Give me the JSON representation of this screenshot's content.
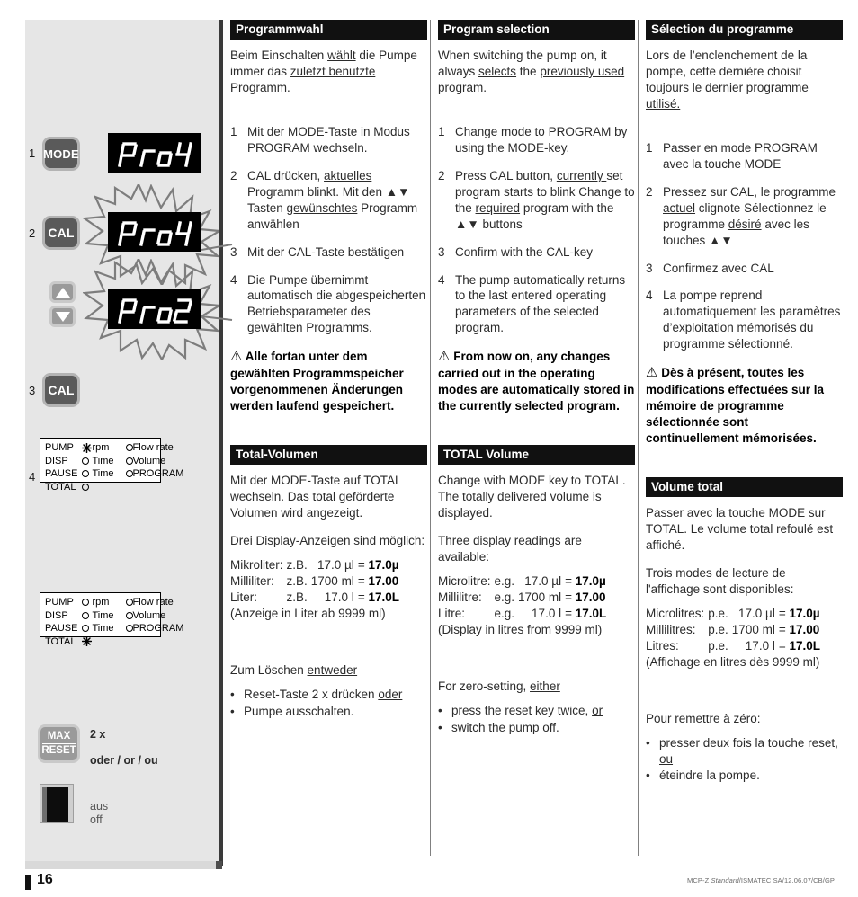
{
  "page": {
    "number": "16",
    "footer_right_prefix": "MCP-Z ",
    "footer_right_italic": "Standard",
    "footer_right_suffix": "/ISMATEC SA/12.06.07/CB/GP"
  },
  "illustration": {
    "steps": [
      "1",
      "2",
      "3",
      "4"
    ],
    "buttons": {
      "mode": "MODE",
      "cal_1": "CAL",
      "cal_2": "CAL",
      "max": "MAX",
      "reset": "RESET"
    },
    "displays": {
      "lcd_1": "Pro4",
      "lcd_2": "Pro4",
      "lcd_3": "Pro2"
    },
    "notes": {
      "two_x": "2 x",
      "or_trilingual": "oder / or / ou",
      "off_de": "aus",
      "off_en": "off"
    },
    "status_panel_1": {
      "rows": [
        {
          "label": "PUMP",
          "c1_mark": "star",
          "c1_text": "rpm",
          "c2_mark": "ring",
          "c2_text": "Flow rate"
        },
        {
          "label": "DISP",
          "c1_mark": "ring",
          "c1_text": "Time",
          "c2_mark": "ring",
          "c2_text": "Volume"
        },
        {
          "label": "PAUSE",
          "c1_mark": "ring",
          "c1_text": "Time",
          "c2_mark": "ring",
          "c2_text": "PROGRAM"
        },
        {
          "label": "TOTAL",
          "c1_mark": "ring",
          "c1_text": "",
          "c2_mark": "",
          "c2_text": ""
        }
      ]
    },
    "status_panel_2": {
      "rows": [
        {
          "label": "PUMP",
          "c1_mark": "ring",
          "c1_text": "rpm",
          "c2_mark": "ring",
          "c2_text": "Flow rate"
        },
        {
          "label": "DISP",
          "c1_mark": "ring",
          "c1_text": "Time",
          "c2_mark": "ring",
          "c2_text": "Volume"
        },
        {
          "label": "PAUSE",
          "c1_mark": "ring",
          "c1_text": "Time",
          "c2_mark": "ring",
          "c2_text": "PROGRAM"
        },
        {
          "label": "TOTAL",
          "c1_mark": "star",
          "c1_text": "",
          "c2_mark": "",
          "c2_text": ""
        }
      ]
    }
  },
  "columns": {
    "de": {
      "section1": {
        "heading": "Programmwahl",
        "intro_a": "Beim Einschalten ",
        "intro_u1": "wählt",
        "intro_b": " die Pumpe immer das ",
        "intro_u2": "zuletzt benutzte",
        "intro_c": " Programm.",
        "steps": [
          {
            "n": "1",
            "text": "Mit der MODE-Taste in Modus PROGRAM wechseln."
          },
          {
            "n": "2",
            "a": "CAL drücken, ",
            "u1": "aktuelles",
            "b": " Programm blinkt. Mit den ▲▼ Tasten ",
            "u2": "gewünschtes",
            "c": " Programm anwählen"
          },
          {
            "n": "3",
            "text": "Mit der CAL-Taste bestätigen"
          },
          {
            "n": "4",
            "text": "Die Pumpe übernimmt automatisch die abgespeicherten Betriebsparameter des gewählten Programms."
          }
        ],
        "warning": "Alle fortan unter dem gewählten Programmspeicher vorgenommenen Änderungen werden laufend gespeichert."
      },
      "section2": {
        "heading": "Total-Volumen",
        "p1": "Mit der MODE-Taste auf TOTAL wechseln. Das total geförderte Volumen wird angezeigt.",
        "p2": "Drei Display-Anzeigen sind möglich:",
        "units": [
          {
            "name": "Mikroliter:",
            "eg": "z.B.",
            "value": "17.0 µl",
            "eq": "=",
            "result": "17.0µ"
          },
          {
            "name": "Milliliter:",
            "eg": "z.B.",
            "value": "1700 ml",
            "eq": "=",
            "result": "17.00"
          },
          {
            "name": "Liter:",
            "eg": "z.B.",
            "value": "17.0 l",
            "eq": "=",
            "result": "17.0L"
          }
        ],
        "note": "(Anzeige in Liter ab 9999 ml)",
        "reset_lead_a": "Zum Löschen ",
        "reset_lead_u": "entweder",
        "bullets": [
          {
            "a": "Reset-Taste 2 x drücken ",
            "u": "oder",
            "b": ""
          },
          {
            "a": "Pumpe ausschalten.",
            "u": "",
            "b": ""
          }
        ]
      }
    },
    "en": {
      "section1": {
        "heading": "Program selection",
        "intro_a": "When switching the pump on, it always ",
        "intro_u1": "selects",
        "intro_b": " the ",
        "intro_u2": "previously used",
        "intro_c": " program.",
        "steps": [
          {
            "n": "1",
            "text": "Change mode to PROGRAM by using the MODE-key."
          },
          {
            "n": "2",
            "a": "Press CAL button, ",
            "u1": "currently ",
            "b": "set program starts to blink Change to the ",
            "u2": "required",
            "c": " program with the ▲▼ buttons"
          },
          {
            "n": "3",
            "text": "Confirm with the CAL-key"
          },
          {
            "n": "4",
            "text": "The pump automatically returns to the last entered operating parameters of the selected program."
          }
        ],
        "warning": "From now on, any changes carried out in the operating modes are  automatically stored in the currently selected program."
      },
      "section2": {
        "heading": "TOTAL Volume",
        "p1": "Change with MODE key to TOTAL. The totally delivered volume is displayed.",
        "p2": "Three display readings are available:",
        "units": [
          {
            "name": "Microlitre:",
            "eg": "e.g.",
            "value": "17.0 µl",
            "eq": "=",
            "result": "17.0µ"
          },
          {
            "name": "Millilitre:",
            "eg": "e.g.",
            "value": "1700 ml",
            "eq": "=",
            "result": "17.00"
          },
          {
            "name": "Litre:",
            "eg": "e.g.",
            "value": "17.0 l",
            "eq": "=",
            "result": "17.0L"
          }
        ],
        "note": "(Display in litres from 9999 ml)",
        "reset_lead_a": "For zero-setting, ",
        "reset_lead_u": "either",
        "bullets": [
          {
            "a": "press the reset key twice, ",
            "u": "or",
            "b": ""
          },
          {
            "a": "switch the pump off.",
            "u": "",
            "b": ""
          }
        ]
      }
    },
    "fr": {
      "section1": {
        "heading": "Sélection du programme",
        "intro_a": "Lors de l’enclenchement de la pompe, cette dernière choisit ",
        "intro_u1": "toujours le dernier programme utilisé.",
        "intro_b": "",
        "intro_u2": "",
        "intro_c": "",
        "steps": [
          {
            "n": "1",
            "text": "Passer en mode PROGRAM avec la touche MODE"
          },
          {
            "n": "2",
            "a": "Pressez sur CAL, le programme ",
            "u1": "actuel",
            "b": " clignote Sélectionnez le programme ",
            "u2": "désiré",
            "c": " avec les touches ▲▼"
          },
          {
            "n": "3",
            "text": "Confirmez avec CAL"
          },
          {
            "n": "4",
            "text": "La pompe reprend automatiquement les paramètres d’exploitation mémorisés du programme sélectionné."
          }
        ],
        "warning": "Dès à présent, toutes les modifications effectuées sur la mémoire de programme sélectionnée sont continuellement mémorisées."
      },
      "section2": {
        "heading": "Volume total",
        "p1": "Passer avec la touche MODE sur TOTAL. Le volume total refoulé est affiché.",
        "p2": "Trois modes de lecture de l'affichage sont disponibles:",
        "units": [
          {
            "name": "Microlitres:",
            "eg": "p.e.",
            "value": "17.0 µl",
            "eq": "=",
            "result": "17.0µ"
          },
          {
            "name": "Millilitres:",
            "eg": "p.e.",
            "value": "1700 ml",
            "eq": "=",
            "result": "17.00"
          },
          {
            "name": "Litres:",
            "eg": "p.e.",
            "value": "17.0 l",
            "eq": "=",
            "result": "17.0L"
          }
        ],
        "note": "(Affichage en litres dès 9999 ml)",
        "reset_lead_a": "Pour remettre à zéro:",
        "reset_lead_u": "",
        "bullets": [
          {
            "a": "presser deux fois la touche reset, ",
            "u": "ou",
            "b": ""
          },
          {
            "a": "éteindre la pompe.",
            "u": "",
            "b": ""
          }
        ]
      }
    }
  }
}
